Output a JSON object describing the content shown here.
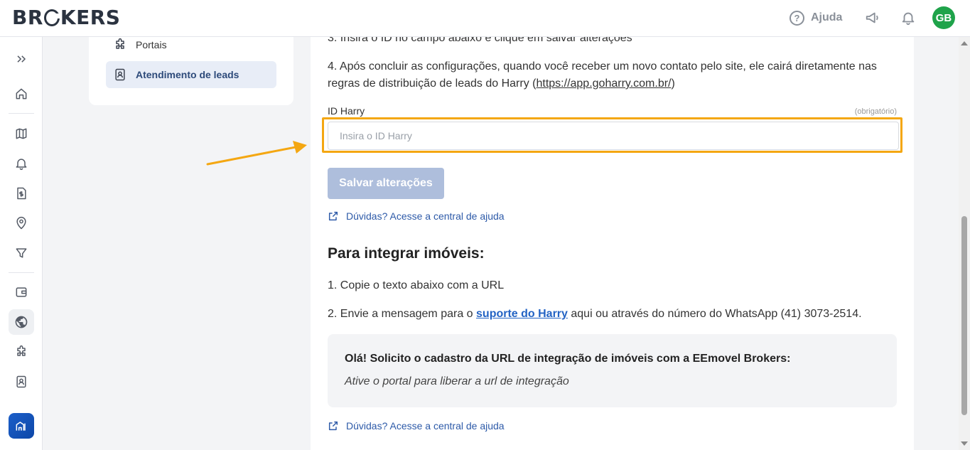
{
  "header": {
    "logo_pre": "BR",
    "logo_post": "KERS",
    "help_label": "Ajuda",
    "avatar_initials": "GB",
    "colors": {
      "avatar": "#1fa34a"
    }
  },
  "sidebar": {
    "icons": [
      "expand-icon",
      "home-icon",
      "map-icon",
      "bell-icon",
      "dollar-document-icon",
      "location-user-icon",
      "filter-icon",
      "wallet-icon",
      "globe-icon",
      "puzzle-icon",
      "contact-card-icon",
      "brand-building-icon"
    ],
    "active": "globe-icon"
  },
  "submenu": {
    "items": [
      {
        "label": "Portais",
        "icon": "puzzle-icon"
      },
      {
        "label": "Atendimento de leads",
        "icon": "contact-card-icon",
        "active": true
      }
    ]
  },
  "content": {
    "step3": "3. Insira o ID no campo abaixo e clique em salvar alterações",
    "step4_text": "4. Após concluir as configurações, quando você receber um novo contato pelo site, ele cairá diretamente nas regras de distribuição de leads do Harry (",
    "step4_link": "https://app.goharry.com.br/",
    "step4_end": ")",
    "field_label": "ID Harry",
    "field_required": "(obrigatório)",
    "field_placeholder": "Insira o ID Harry",
    "field_value": "",
    "save_label": "Salvar alterações",
    "help_link_1": "Dúvidas? Acesse a central de ajuda",
    "section_title": "Para integrar imóveis:",
    "imoveis_step1": "1. Copie o texto abaixo com a URL",
    "imoveis_step2_pre": "2. Envie a mensagem para o ",
    "imoveis_step2_link": "suporte do Harry",
    "imoveis_step2_post": " aqui ou através do número do WhatsApp (41) 3073-2514.",
    "message_title": "Olá! Solicito o cadastro da URL de integração de imóveis com a EEmovel Brokers:",
    "message_body": "Ative o portal para liberar a url de integração",
    "help_link_2": "Dúvidas? Acesse a central de ajuda",
    "colors": {
      "highlight": "#f4a712",
      "arrow": "#f4a712",
      "save_disabled": "#aebedc",
      "link": "#2363c4"
    }
  }
}
